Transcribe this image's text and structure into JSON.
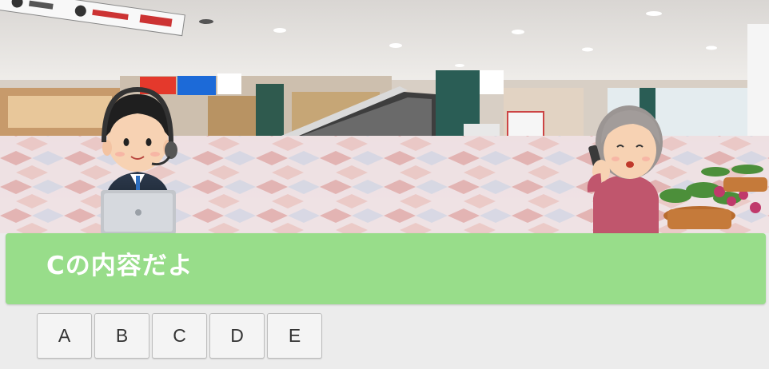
{
  "dialog": {
    "text": "Cの内容だよ"
  },
  "choices": [
    {
      "label": "A"
    },
    {
      "label": "B"
    },
    {
      "label": "C"
    },
    {
      "label": "D"
    },
    {
      "label": "E"
    }
  ],
  "scene": {
    "description_free": true,
    "characters": [
      "operator-with-headset-and-laptop",
      "elderly-woman-on-phone"
    ]
  }
}
